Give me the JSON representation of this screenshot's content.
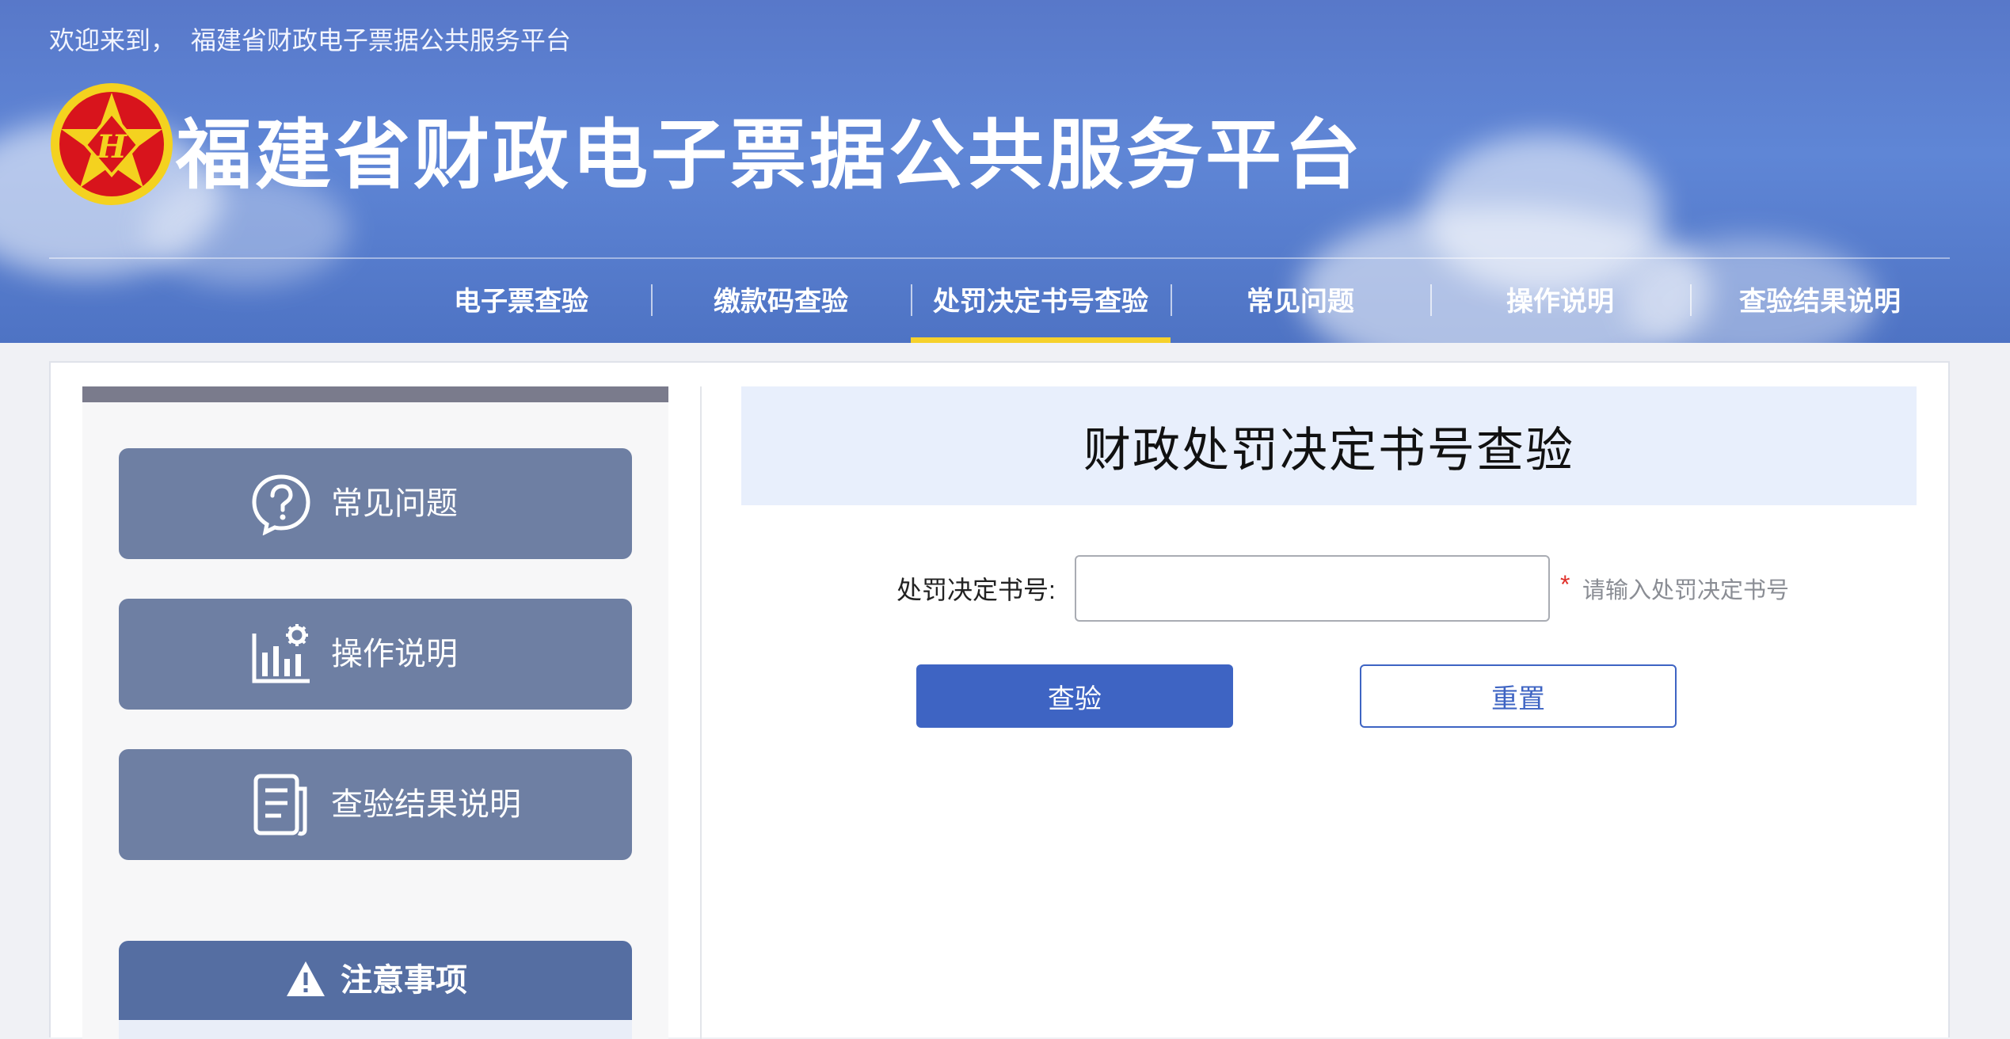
{
  "header": {
    "welcome_prefix": "欢迎来到，",
    "welcome_site": "福建省财政电子票据公共服务平台",
    "site_title": "福建省财政电子票据公共服务平台",
    "logo_letter": "H"
  },
  "nav": {
    "items": [
      {
        "label": "电子票查验"
      },
      {
        "label": "缴款码查验"
      },
      {
        "label": "处罚决定书号查验",
        "active": true
      },
      {
        "label": "常见问题"
      },
      {
        "label": "操作说明"
      },
      {
        "label": "查验结果说明"
      }
    ]
  },
  "sidebar": {
    "buttons": [
      {
        "label": "常见问题",
        "icon": "question-icon"
      },
      {
        "label": "操作说明",
        "icon": "chart-gear-icon"
      },
      {
        "label": "查验结果说明",
        "icon": "document-icon"
      }
    ],
    "notice_title": "注意事项",
    "notice_icon": "warning-icon"
  },
  "form": {
    "title": "财政处罚决定书号查验",
    "field_label": "处罚决定书号:",
    "field_value": "",
    "required_mark": "*",
    "hint": "请输入处罚决定书号",
    "submit_label": "查验",
    "reset_label": "重置"
  },
  "colors": {
    "header_blue": "#5878c9",
    "active_underline": "#f6d12c",
    "sidebar_button": "#6e7fa3",
    "notice_header": "#556ea2",
    "primary_button": "#3e64c3",
    "title_box": "#e8effc",
    "required": "#e0302a"
  }
}
